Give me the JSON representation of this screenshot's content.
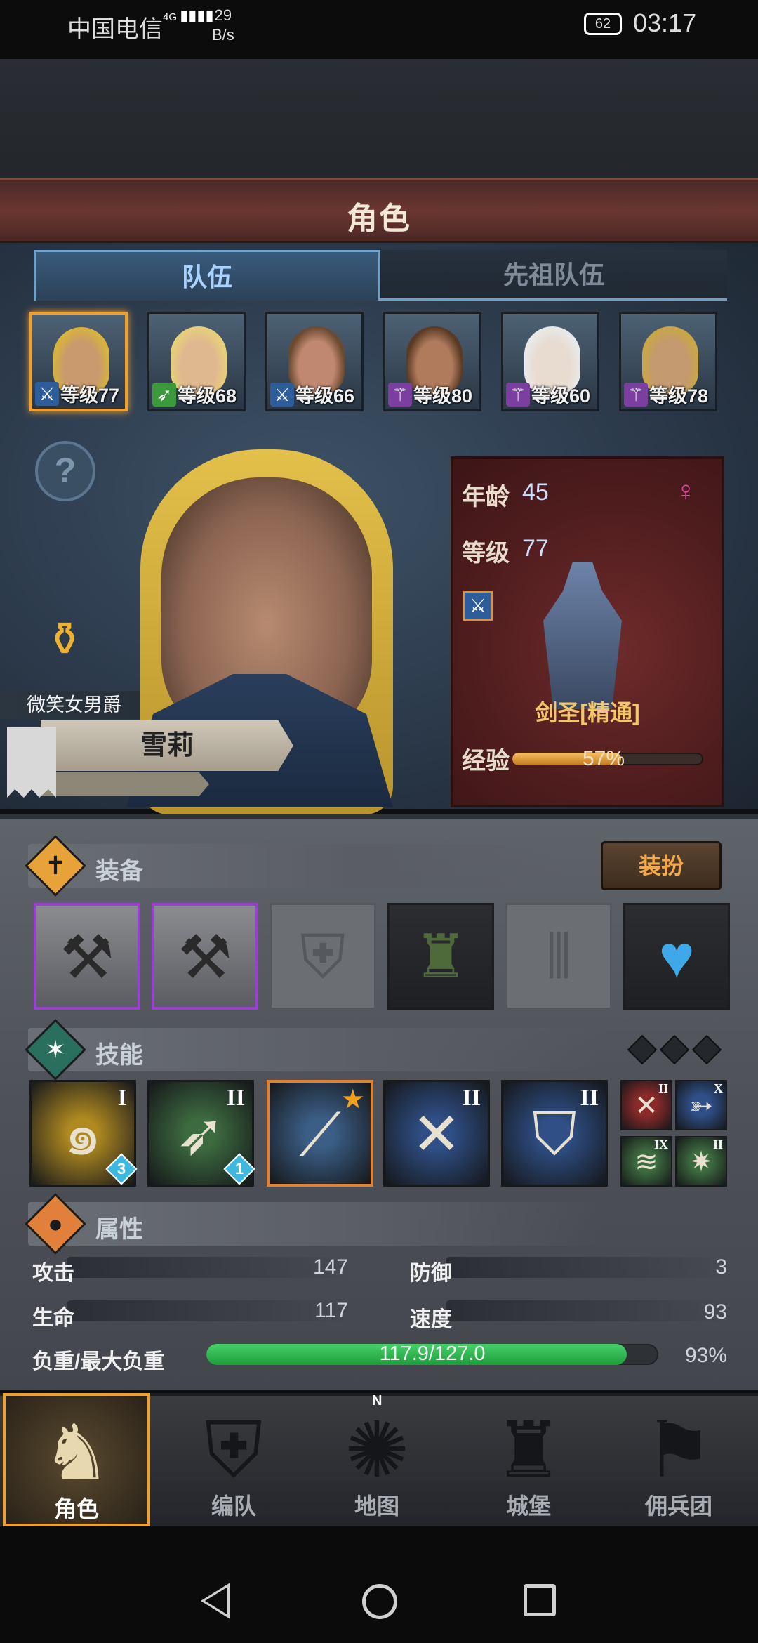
{
  "status_bar": {
    "carrier": "中国电信",
    "network": "4G",
    "speed_value": "29",
    "speed_unit": "B/s",
    "battery": "62",
    "time": "03:17"
  },
  "header": {
    "title": "角色"
  },
  "tabs": [
    {
      "label": "队伍",
      "active": true
    },
    {
      "label": "先祖队伍",
      "active": false
    }
  ],
  "roster": [
    {
      "level_text": "等级77",
      "class_color": "#2e5d9c",
      "class_icon": "sword-icon",
      "selected": true
    },
    {
      "level_text": "等级68",
      "class_color": "#3c9a3c",
      "class_icon": "bow-icon",
      "selected": false
    },
    {
      "level_text": "等级66",
      "class_color": "#2e5d9c",
      "class_icon": "sword-icon",
      "selected": false
    },
    {
      "level_text": "等级80",
      "class_color": "#7b3fa0",
      "class_icon": "staff-icon",
      "selected": false
    },
    {
      "level_text": "等级60",
      "class_color": "#7b3fa0",
      "class_icon": "staff-icon",
      "selected": false
    },
    {
      "level_text": "等级78",
      "class_color": "#7b3fa0",
      "class_icon": "staff-icon",
      "selected": false
    }
  ],
  "character": {
    "trait": "微笑女男爵",
    "name": "雪莉",
    "age_label": "年龄",
    "age": "45",
    "level_label": "等级",
    "level": "77",
    "class_name": "剑圣[精通]",
    "exp_label": "经验",
    "exp_percent": "57%",
    "exp_fraction": 0.57,
    "gender": "female"
  },
  "equipment": {
    "title": "装备",
    "dress_button": "装扮",
    "slots": [
      {
        "name": "weapon-slot-1",
        "state": "purple",
        "icon": "axe-icon"
      },
      {
        "name": "weapon-slot-2",
        "state": "purple",
        "icon": "axe-icon"
      },
      {
        "name": "helmet-slot",
        "state": "empty",
        "icon": "helmet-icon"
      },
      {
        "name": "armor-slot",
        "state": "filled",
        "icon": "tunic-icon"
      },
      {
        "name": "boots-slot",
        "state": "empty",
        "icon": "boots-icon"
      },
      {
        "name": "amulet-slot",
        "state": "filled",
        "icon": "heart-amulet-icon"
      }
    ]
  },
  "skills": {
    "title": "技能",
    "items": [
      {
        "rank": "I",
        "gem": "3",
        "bg": "#b08a20",
        "icon": "whirlwind-icon"
      },
      {
        "rank": "II",
        "gem": "1",
        "bg": "#3d6b40",
        "icon": "charge-icon"
      },
      {
        "rank": "",
        "gem": "",
        "bg": "#3b5e86",
        "icon": "slash-icon",
        "starred": true
      },
      {
        "rank": "II",
        "gem": "",
        "bg": "#2f4f86",
        "icon": "sword-strike-icon"
      },
      {
        "rank": "II",
        "gem": "",
        "bg": "#2f4f86",
        "icon": "shield-bash-icon"
      }
    ],
    "mini": [
      {
        "rank": "II",
        "bg": "#8c2a2a",
        "icon": "blade-icon"
      },
      {
        "rank": "X",
        "bg": "#2f4f86",
        "icon": "bird-icon"
      },
      {
        "rank": "IX",
        "bg": "#3d6b40",
        "icon": "wave-icon"
      },
      {
        "rank": "II",
        "bg": "#3d6b40",
        "icon": "burst-icon"
      }
    ]
  },
  "attributes": {
    "title": "属性",
    "attack_label": "攻击",
    "attack": "147",
    "defense_label": "防御",
    "defense": "3",
    "hp_label": "生命",
    "hp": "117",
    "speed_label": "速度",
    "speed": "93",
    "load_label": "负重/最大负重",
    "load": "117.9/127.0",
    "load_percent": "93%",
    "load_fraction": 0.93
  },
  "nav": [
    {
      "label": "角色",
      "active": true,
      "icon": "knight-icon"
    },
    {
      "label": "编队",
      "active": false,
      "icon": "helmet-icon"
    },
    {
      "label": "地图",
      "active": false,
      "icon": "compass-icon"
    },
    {
      "label": "城堡",
      "active": false,
      "icon": "castle-icon"
    },
    {
      "label": "佣兵团",
      "active": false,
      "icon": "banner-icon"
    }
  ],
  "compass_letter": "N"
}
